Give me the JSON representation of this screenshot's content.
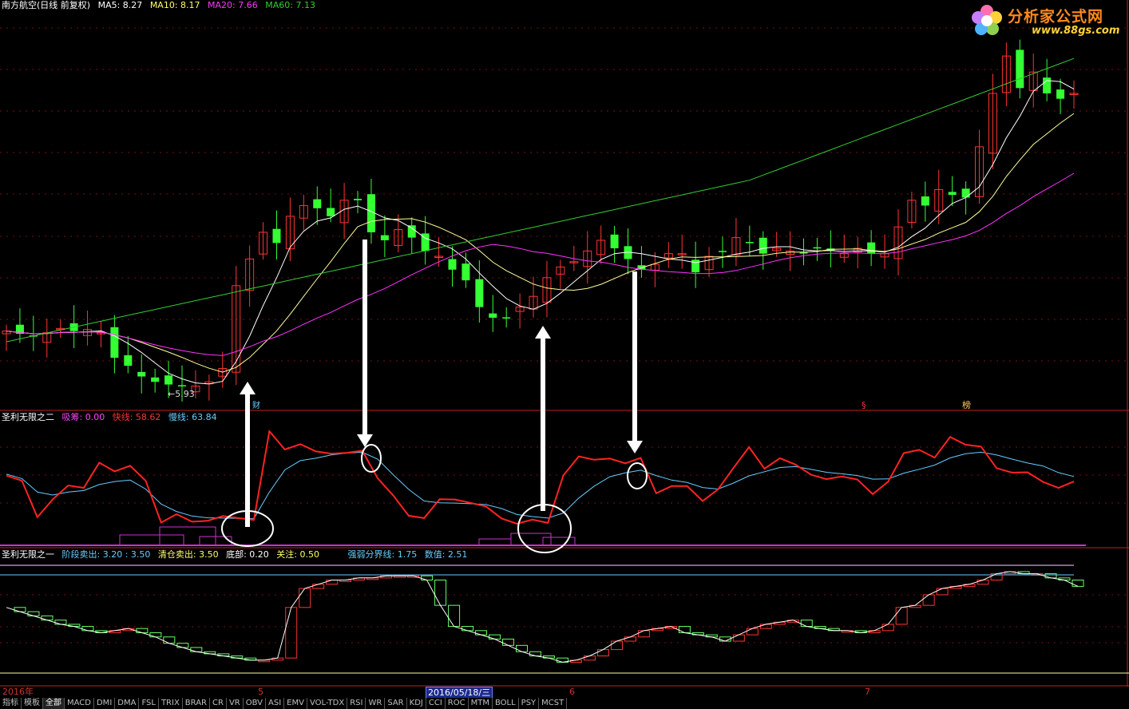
{
  "main_panel": {
    "title": "南方航空(日线 前复权)",
    "ma": [
      {
        "label": "MA5: 8.27",
        "color": "#ffffff"
      },
      {
        "label": "MA10: 8.17",
        "color": "#ffff66"
      },
      {
        "label": "MA20: 7.66",
        "color": "#ff33ff"
      },
      {
        "label": "MA60: 7.13",
        "color": "#33cc33"
      }
    ],
    "low_marker": "←5.93",
    "markers": [
      "财",
      "§",
      "榜"
    ]
  },
  "panel2": {
    "title": "圣利无限之二",
    "items": [
      {
        "label": "吸筹: 0.00",
        "color": "#ff44ff"
      },
      {
        "label": "快线: 58.62",
        "color": "#ff3333"
      },
      {
        "label": "慢线: 63.84",
        "color": "#66ccff"
      }
    ]
  },
  "panel3": {
    "title": "圣利无限之一",
    "items": [
      {
        "label": "阶段卖出: 3.20 : 3.50",
        "color": "#66ccff"
      },
      {
        "label": "清仓卖出: 3.50",
        "color": "#ffff66"
      },
      {
        "label": "底部: 0.20",
        "color": "#ffffff"
      },
      {
        "label": "关注: 0.50",
        "color": "#ffff66"
      },
      {
        "label": "强弱分界线: 1.75",
        "color": "#66ccff"
      },
      {
        "label": "数值: 2.51",
        "color": "#66ccff"
      }
    ]
  },
  "logo": {
    "name": "分析家公式网",
    "url": "www.88gs.com"
  },
  "axis_dates": {
    "year": "2016年",
    "m5": "5",
    "cursor": "2016/05/18/三",
    "m6": "6",
    "m7": "7"
  },
  "tabs": [
    "指标",
    "模板",
    "全部",
    "MACD",
    "DMI",
    "DMA",
    "FSL",
    "TRIX",
    "BRAR",
    "CR",
    "VR",
    "OBV",
    "ASI",
    "EMV",
    "VOL-TDX",
    "RSI",
    "WR",
    "SAR",
    "KDJ",
    "CCI",
    "ROC",
    "MTM",
    "BOLL",
    "PSY",
    "MCST"
  ],
  "active_tab": "全部",
  "chart_data": {
    "type": "candlestick",
    "prices": [
      7.05,
      7.0,
      6.95,
      7.02,
      7.1,
      7.05,
      7.08,
      7.02,
      6.55,
      6.4,
      6.2,
      6.1,
      6.05,
      6.03,
      6.02,
      6.1,
      6.35,
      7.9,
      8.4,
      8.9,
      8.7,
      9.2,
      9.4,
      9.35,
      9.2,
      9.5,
      9.5,
      8.9,
      8.75,
      8.95,
      8.8,
      8.55,
      8.45,
      8.2,
      8.0,
      7.5,
      7.3,
      7.3,
      7.5,
      7.7,
      8.05,
      8.25,
      8.35,
      8.55,
      8.75,
      8.6,
      8.4,
      8.2,
      8.3,
      8.5,
      8.5,
      8.15,
      8.45,
      8.55,
      8.8,
      8.7,
      8.5,
      8.6,
      8.55,
      8.5,
      8.6,
      8.55,
      8.5,
      8.6,
      8.5,
      8.5,
      9.0,
      9.5,
      9.4,
      9.7,
      9.6,
      9.55,
      10.5,
      11.5,
      12.2,
      11.6,
      11.9,
      11.5,
      11.4,
      11.5
    ],
    "oscillator_fast": [
      62.5,
      60.8,
      48.6,
      54.6,
      59.2,
      58.4,
      66.8,
      63.9,
      65.8,
      60.8,
      46.8,
      49.6,
      47.1,
      47.4,
      49.0,
      48.3,
      47.7,
      77.3,
      71.2,
      73.0,
      70.6,
      69.8,
      70.1,
      70.8,
      61.6,
      55.9,
      49.1,
      48.3,
      54.6,
      54.5,
      53.4,
      52.2,
      48.2,
      46.4,
      47.8,
      46.7,
      62.6,
      68.9,
      67.8,
      68.2,
      66.6,
      68.4,
      56.6,
      59.0,
      59.0,
      54.0,
      57.9,
      65.1,
      72.0,
      64.8,
      68.3,
      66.2,
      62.8,
      61.3,
      62.2,
      61.2,
      56.3,
      60.5,
      70.0,
      71.1,
      68.5,
      75.4,
      72.8,
      72.2,
      65.0,
      63.5,
      63.6,
      60.4,
      58.4,
      60.5
    ],
    "oscillator_slow": [
      63.0,
      61.5,
      57.0,
      56.0,
      57.0,
      57.5,
      59.5,
      60.5,
      61.0,
      58.0,
      53.0,
      50.5,
      49.0,
      48.4,
      48.3,
      48.2,
      48.1,
      57.0,
      64.4,
      67.5,
      68.3,
      69.4,
      70.0,
      70.3,
      68.0,
      62.8,
      57.9,
      54.0,
      53.4,
      53.3,
      53.1,
      52.8,
      51.5,
      49.5,
      48.8,
      48.3,
      50.0,
      55.0,
      59.0,
      62.1,
      63.4,
      64.3,
      62.5,
      61.0,
      60.2,
      58.5,
      58.0,
      60.0,
      62.4,
      63.8,
      65.2,
      65.5,
      64.6,
      63.6,
      63.1,
      62.5,
      61.3,
      61.4,
      63.3,
      64.6,
      66.0,
      68.4,
      69.8,
      70.3,
      69.4,
      68.0,
      66.7,
      65.7,
      63.5,
      62.2
    ],
    "bottom_line": [
      3.0,
      2.8,
      2.6,
      2.4,
      2.2,
      2.1,
      1.9,
      1.8,
      1.9,
      2.0,
      1.8,
      1.6,
      1.3,
      1.1,
      0.9,
      0.8,
      0.7,
      0.6,
      0.5,
      0.5,
      0.6,
      3.0,
      3.9,
      4.1,
      4.3,
      4.3,
      4.4,
      4.4,
      4.5,
      4.5,
      4.5,
      4.3,
      3.1,
      2.1,
      1.9,
      1.7,
      1.5,
      1.2,
      0.9,
      0.7,
      0.6,
      0.4,
      0.5,
      0.7,
      1.0,
      1.4,
      1.6,
      1.9,
      2.0,
      2.1,
      1.8,
      1.7,
      1.6,
      1.4,
      1.7,
      2.0,
      2.2,
      2.3,
      2.4,
      2.1,
      2.0,
      1.9,
      1.9,
      1.8,
      1.9,
      2.2,
      3.0,
      3.1,
      3.6,
      3.9,
      4.0,
      4.1,
      4.3,
      4.6,
      4.7,
      4.6,
      4.6,
      4.4,
      4.3,
      4.0
    ]
  }
}
